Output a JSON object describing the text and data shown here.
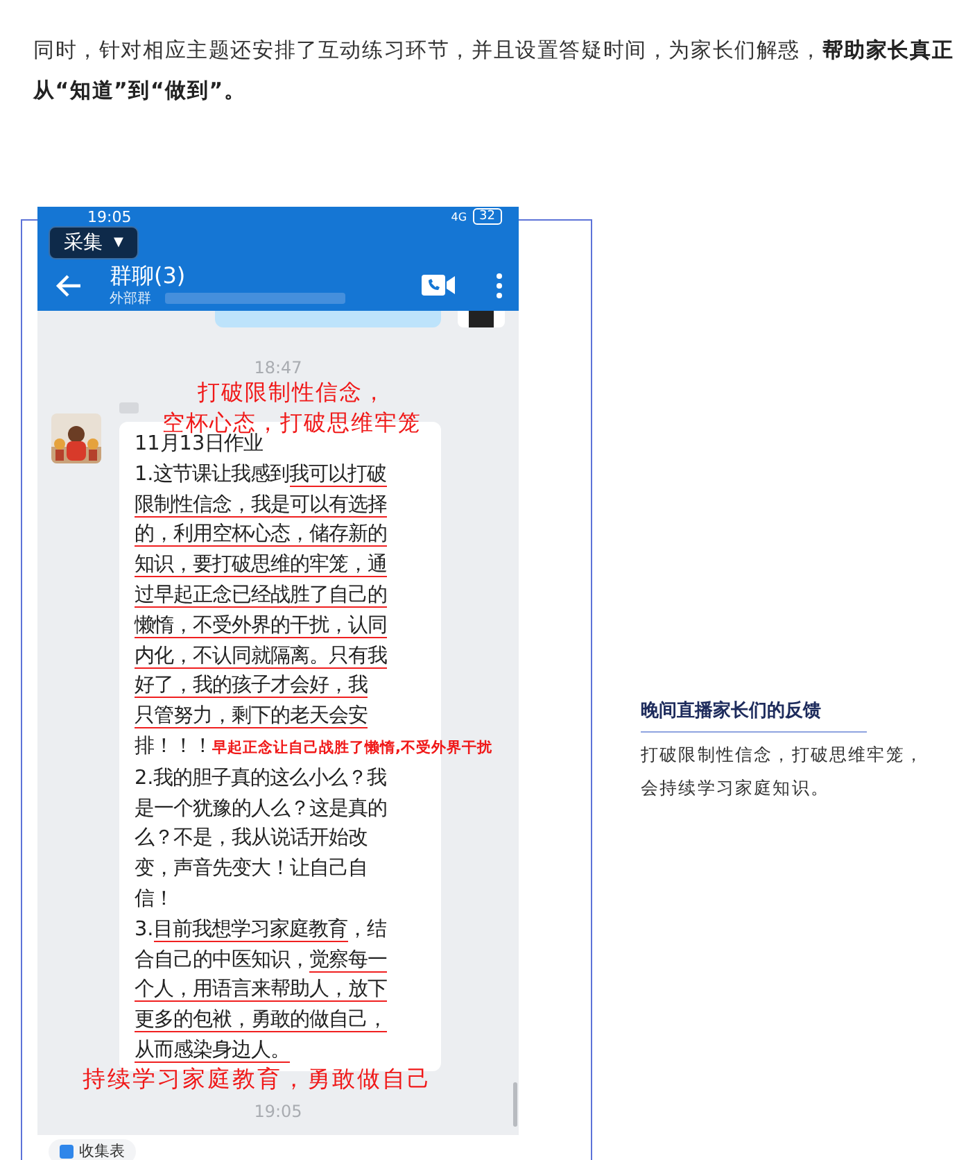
{
  "intro": "同时，针对相应主题还安排了互动练习环节，并且设置答疑时间，为家长们解惑，**帮助家长真正从“知道”到“做到”。**",
  "phone": {
    "status_bar": {
      "time": "19:05",
      "network": "4G",
      "battery": "32"
    },
    "capture_button": {
      "label": "采集",
      "caret": "▼"
    },
    "chat_header": {
      "title": "群聊(3)",
      "subtitle": "外部群"
    },
    "messages": [
      {
        "kind": "time",
        "text": "18:47"
      },
      {
        "kind": "annotation",
        "text": "打破限制性信念，"
      },
      {
        "kind": "annotation",
        "text": "空杯心态，打破思维牢笼"
      },
      {
        "kind": "bubble",
        "lines": [
          [
            {
              "text": "11月13日作业",
              "underlined": false
            }
          ],
          [
            {
              "text": "1.这节课让我感到",
              "underlined": false
            },
            {
              "text": "我可以打破",
              "underlined": true
            }
          ],
          [
            {
              "text": "限制性信念，我是可以有选择",
              "underlined": true
            }
          ],
          [
            {
              "text": "的，利用空杯心态，储存新的",
              "underlined": true
            }
          ],
          [
            {
              "text": "知识，要打破思维的牢笼，通",
              "underlined": true
            }
          ],
          [
            {
              "text": "过早起正念已经战胜了自己的",
              "underlined": true
            }
          ],
          [
            {
              "text": "懒惰，不受外界的干扰，认同",
              "underlined": true
            }
          ],
          [
            {
              "text": "内化，不认同就隔离。只有我",
              "underlined": true
            }
          ],
          [
            {
              "text": "好了，我的孩子才会好，我",
              "underlined": true
            }
          ],
          [
            {
              "text": "只管努力，剩下的老天会安",
              "underlined": true
            }
          ],
          [
            {
              "text": "排！！！",
              "underlined": false
            },
            {
              "text": "早起正念让自己战胜了懒惰,不受外界干扰",
              "underlined": false,
              "kind": "note"
            }
          ],
          [
            {
              "text": "2.我的胆子真的这么小么？我",
              "underlined": false
            }
          ],
          [
            {
              "text": "是一个犹豫的人么？这是真的",
              "underlined": false
            }
          ],
          [
            {
              "text": "么？不是，我从说话开始改",
              "underlined": false
            }
          ],
          [
            {
              "text": "变，声音先变大！让自己自",
              "underlined": false
            }
          ],
          [
            {
              "text": "信！",
              "underlined": false
            }
          ],
          [
            {
              "text": "3.",
              "underlined": false
            },
            {
              "text": "目前我想学习家庭教育",
              "underlined": true
            },
            {
              "text": "，结",
              "underlined": false
            }
          ],
          [
            {
              "text": "合自己的中医知识，",
              "underlined": false
            },
            {
              "text": "觉察每一",
              "underlined": true
            }
          ],
          [
            {
              "text": "个人，用语言来帮助人，放下",
              "underlined": true
            }
          ],
          [
            {
              "text": "更多的包袱，勇敢的做自己，",
              "underlined": true
            }
          ],
          [
            {
              "text": "从而感染身边人。",
              "underlined": true
            }
          ]
        ]
      },
      {
        "kind": "annotation_large",
        "text": "持续学习家庭教育，勇敢做自己"
      },
      {
        "kind": "time",
        "text": "19:05"
      }
    ],
    "bottom_chip": "收集表"
  },
  "caption": {
    "title": "晚间直播家长们的反馈",
    "text": "打破限制性信念，打破思维牢笼，会持续学习家庭知识。"
  }
}
